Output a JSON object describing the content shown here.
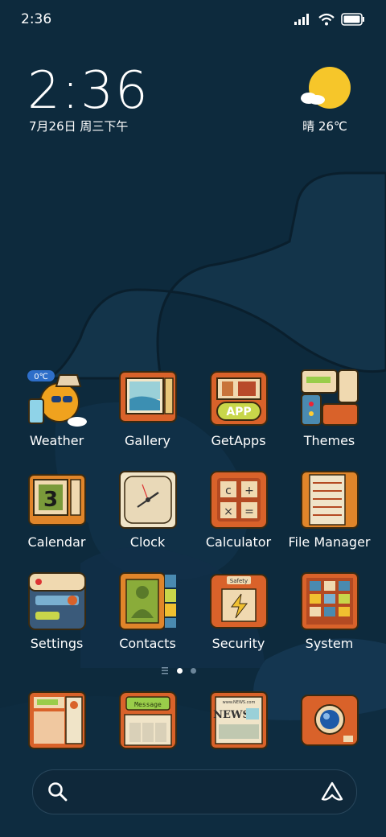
{
  "status_bar": {
    "time": "2:36"
  },
  "home_clock": {
    "time": "2:36",
    "date": "7月26日 周三下午"
  },
  "weather": {
    "condition": "晴",
    "temperature": "26℃"
  },
  "apps": [
    {
      "label": "Weather",
      "badge": "0℃"
    },
    {
      "label": "Gallery"
    },
    {
      "label": "GetApps",
      "badge": "APP"
    },
    {
      "label": "Themes"
    },
    {
      "label": "Calendar",
      "badge": "3"
    },
    {
      "label": "Clock"
    },
    {
      "label": "Calculator"
    },
    {
      "label": "File Manager"
    },
    {
      "label": "Settings"
    },
    {
      "label": "Contacts"
    },
    {
      "label": "Security",
      "badge": "Safety"
    },
    {
      "label": "System"
    }
  ],
  "dock": {
    "messaging_badge": "Message",
    "news_badge": "NEWS",
    "news_site": "www.NEWS.com"
  },
  "colors": {
    "background": "#0d2a3d",
    "sun": "#f6c62a",
    "icon_orange": "#e0622b"
  }
}
